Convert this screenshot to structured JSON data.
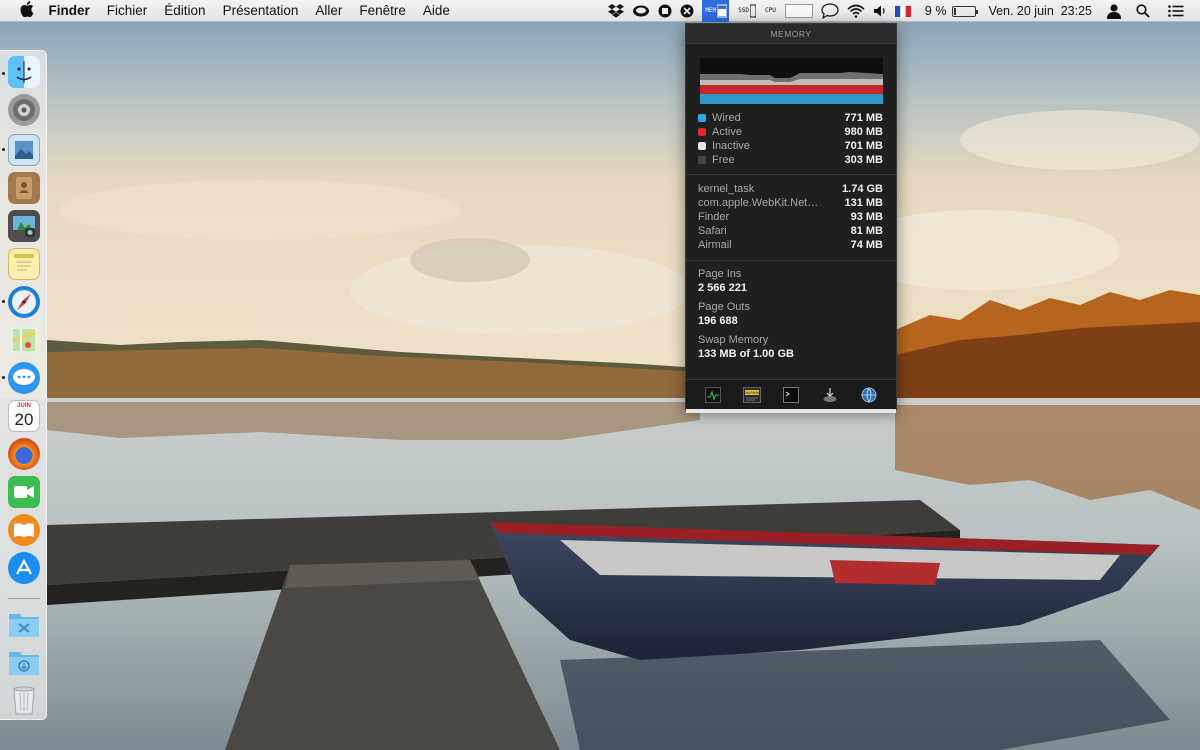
{
  "menubar": {
    "apple_icon": "apple-logo-icon",
    "app_name": "Finder",
    "menus": [
      "Fichier",
      "Édition",
      "Présentation",
      "Aller",
      "Fenêtre",
      "Aide"
    ],
    "status": {
      "icons": [
        "dropbox-icon",
        "cloud-icon",
        "record-icon",
        "airplane-icon",
        "mem-monitor-icon",
        "ssd-monitor-icon",
        "cpu-monitor-icon",
        "text-field-icon",
        "chat-bubble-icon",
        "wifi-icon",
        "volume-icon",
        "french-flag-icon"
      ],
      "mem_label": "MEM",
      "ssd_label": "SSD",
      "cpu_label": "CPU",
      "battery_percent": "9 %",
      "battery_level": 0.09,
      "datetime": "Ven. 20 juin  23:25",
      "user_icon": "user-icon",
      "search_icon": "spotlight-icon",
      "notifications_icon": "notification-center-icon"
    }
  },
  "dock": {
    "items": [
      {
        "name": "finder",
        "icon": "finder-icon",
        "running": true
      },
      {
        "name": "system-preferences",
        "icon": "gear-icon",
        "running": false
      },
      {
        "name": "preview",
        "icon": "preview-icon",
        "running": true
      },
      {
        "name": "contacts",
        "icon": "contacts-icon",
        "running": false
      },
      {
        "name": "image-capture",
        "icon": "camera-icon",
        "running": false
      },
      {
        "name": "notes",
        "icon": "notes-icon",
        "running": false
      },
      {
        "name": "safari",
        "icon": "compass-icon",
        "running": true
      },
      {
        "name": "maps",
        "icon": "map-icon",
        "running": false
      },
      {
        "name": "messages",
        "icon": "chat-icon",
        "running": true
      },
      {
        "name": "calendar",
        "icon": "calendar-icon",
        "running": false
      },
      {
        "name": "firefox",
        "icon": "firefox-icon",
        "running": false
      },
      {
        "name": "facetime",
        "icon": "video-icon",
        "running": false
      },
      {
        "name": "ibooks",
        "icon": "book-icon",
        "running": false
      },
      {
        "name": "app-store",
        "icon": "app-store-icon",
        "running": false
      },
      {
        "name": "applications-folder",
        "icon": "folder-icon",
        "running": false
      },
      {
        "name": "downloads-folder",
        "icon": "folder-download-icon",
        "running": false
      },
      {
        "name": "trash",
        "icon": "trash-icon",
        "running": false
      }
    ],
    "calendar_month": "JUIN",
    "calendar_day": "20"
  },
  "memory_panel": {
    "title": "MEMORY",
    "breakdown": [
      {
        "label": "Wired",
        "value": "771 MB",
        "color": "#2fa8e0"
      },
      {
        "label": "Active",
        "value": "980 MB",
        "color": "#e2232a"
      },
      {
        "label": "Inactive",
        "value": "701 MB",
        "color": "#e6e6e6"
      },
      {
        "label": "Free",
        "value": "303 MB",
        "color": "#444444"
      }
    ],
    "processes": [
      {
        "name": "kernel_task",
        "value": "1.74 GB"
      },
      {
        "name": "com.apple.WebKit.Net…",
        "value": "131 MB"
      },
      {
        "name": "Finder",
        "value": "93 MB"
      },
      {
        "name": "Safari",
        "value": "81 MB"
      },
      {
        "name": "Airmail",
        "value": "74 MB"
      }
    ],
    "page_ins_label": "Page Ins",
    "page_ins_value": "2 566 221",
    "page_outs_label": "Page Outs",
    "page_outs_value": "196 688",
    "swap_label": "Swap Memory",
    "swap_value": "133 MB of 1.00 GB",
    "footer_icons": [
      "activity-monitor-icon",
      "console-icon",
      "terminal-icon",
      "disk-utility-icon",
      "network-utility-icon"
    ],
    "footer_console_label": "WARNIN"
  }
}
